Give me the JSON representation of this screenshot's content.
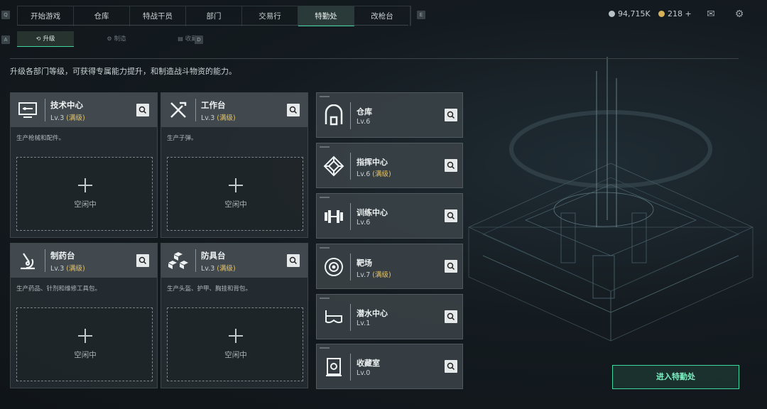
{
  "nav": {
    "left_key": "Q",
    "right_key": "E",
    "tabs": [
      {
        "label": "开始游戏"
      },
      {
        "label": "仓库"
      },
      {
        "label": "特战干员"
      },
      {
        "label": "部门"
      },
      {
        "label": "交易行"
      },
      {
        "label": "特勤处",
        "active": true
      },
      {
        "label": "改枪台"
      }
    ]
  },
  "currency": {
    "coins": "94,715K",
    "tickets": "218 +"
  },
  "subnav": {
    "left_key": "A",
    "right_key": "D",
    "tabs": [
      {
        "label": "升级",
        "glyph": "⟲",
        "active": true
      },
      {
        "label": "制造",
        "glyph": "⚙"
      },
      {
        "label": "收藏",
        "glyph": "▤"
      }
    ]
  },
  "description": "升级各部门等级，可获得专属能力提升，和制造战斗物资的能力。",
  "cards": [
    {
      "name": "技术中心",
      "level": "Lv.3",
      "max": "(满级)",
      "desc": "生产枪械和配件。",
      "slot": "空闲中",
      "icon": "computer-icon"
    },
    {
      "name": "工作台",
      "level": "Lv.3",
      "max": "(满级)",
      "desc": "生产子弹。",
      "slot": "空闲中",
      "icon": "tools-icon"
    },
    {
      "name": "制药台",
      "level": "Lv.3",
      "max": "(满级)",
      "desc": "生产药品、针剂和维修工具包。",
      "slot": "空闲中",
      "icon": "microscope-icon"
    },
    {
      "name": "防具台",
      "level": "Lv.3",
      "max": "(满级)",
      "desc": "生产头盔、护甲、胸挂和背包。",
      "slot": "空闲中",
      "icon": "cubes-icon"
    }
  ],
  "facilities": [
    {
      "name": "仓库",
      "level": "Lv.6",
      "max": "",
      "icon": "warehouse-icon"
    },
    {
      "name": "指挥中心",
      "level": "Lv.6",
      "max": "(满级)",
      "icon": "command-icon"
    },
    {
      "name": "训练中心",
      "level": "Lv.6",
      "max": "",
      "icon": "dumbbell-icon"
    },
    {
      "name": "靶场",
      "level": "Lv.7",
      "max": "(满级)",
      "icon": "target-icon"
    },
    {
      "name": "潜水中心",
      "level": "Lv.1",
      "max": "",
      "icon": "diving-mask-icon"
    },
    {
      "name": "收藏室",
      "level": "Lv.0",
      "max": "",
      "icon": "trophy-case-icon"
    }
  ],
  "enter_button": "进入特勤处",
  "colors": {
    "accent": "#3fd6a0",
    "max_level": "#e4c46a"
  }
}
